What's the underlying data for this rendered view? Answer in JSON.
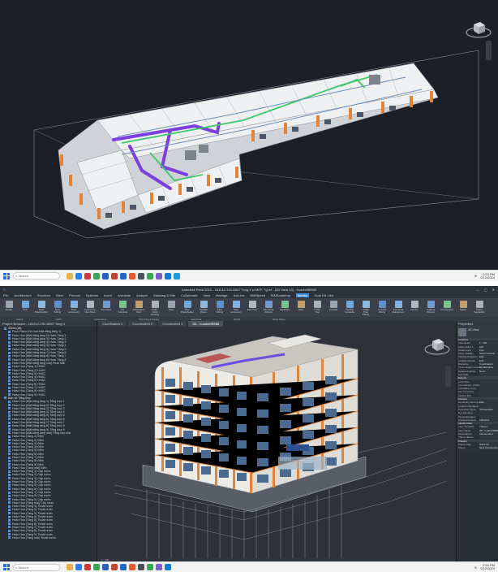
{
  "screen1": {
    "taskbar": {
      "search_placeholder": "Search",
      "time": "2:53 PM",
      "date": "9/12/2024"
    }
  },
  "screen2": {
    "window_title": "Autodesk Revit 2024 - 181012-191-BIM7 Tong 4 (v.MEF, Tg.rvt - {3D View-13} - hoadmi98988",
    "menu_tabs": [
      "File",
      "Architecture",
      "Structure",
      "Steel",
      "Precast",
      "Systems",
      "Insert",
      "Annotate",
      "Analyze",
      "Massing & Site",
      "Collaborate",
      "View",
      "Manage",
      "Add-Ins",
      "BIMSpeed",
      "BIMAcademy",
      "Modify",
      "Xuất Dữ Liệu"
    ],
    "active_tab": "Modify",
    "ribbon_tools": [
      "Modify",
      "Duct",
      "Duct Placeholder",
      "Duct Fitting",
      "Duct Accessory",
      "Convert to Flex Duct",
      "Flex Duct",
      "Air Terminal",
      "Fabrication Part",
      "Multi-Point Routing",
      "Pipe",
      "Pipe Placeholder",
      "Parallel Pipes",
      "Pipe Fitting",
      "Pipe Accessory",
      "Flex Pipe",
      "Plumbing Fixture",
      "Sprinkler",
      "Wire",
      "Cable Tray",
      "Conduit",
      "Parallel Conduits",
      "Cable Tray Fitting",
      "Conduit Fitting",
      "Electrical Equipment",
      "Device",
      "Lighting Fixture",
      "Component",
      "Space",
      "Space Separator"
    ],
    "ribbon_groups": [
      "Select",
      "HVAC",
      "Fabrication",
      "Plumbing & Piping",
      "Electrical",
      "Model",
      "Work Plane"
    ],
    "browser": {
      "title": "Project Browser - 181012-191-BIM7 Tong 4",
      "items": [
        {
          "text": "Views (all)",
          "group": true
        },
        {
          "text": "Floor Plans (Ho ban-Mặt bằng tầng 1)",
          "group": false
        },
        {
          "text": "Hvac Hoa (Mặt bằng tầng 2) Hvac Tầng 1",
          "group": false
        },
        {
          "text": "Hvac Hoa (Mặt bằng tầng 3) Hvac Tầng 2",
          "group": false
        },
        {
          "text": "Hvac Hoa (Mặt bằng tầng 4) Hvac Tầng 3",
          "group": false
        },
        {
          "text": "Hvac Hoa (Mặt bằng tầng 5) Hvac Tầng 4",
          "group": false
        },
        {
          "text": "Hvac Hoa (Mặt bằng tầng 6) Hvac Tầng 5",
          "group": false
        },
        {
          "text": "Hvac Hoa (Mặt bằng tầng 7) Hvac Tầng 6",
          "group": false
        },
        {
          "text": "Hvac Hoa (Mặt bằng tầng 8) Hvac Tầng 7",
          "group": false
        },
        {
          "text": "Hvac Hoa (Mặt bằng tầng 9) Hvac Tầng 8",
          "group": false
        },
        {
          "text": "Hvac Hoa (Mặt bằng tầng mái) Hvac Mái",
          "group": false
        },
        {
          "text": "Hvac Hoa (Tầng 1) HVAC",
          "group": false
        },
        {
          "text": "Hvac Hoa (Tầng 2) HVAC",
          "group": false
        },
        {
          "text": "Hvac Hoa (Tầng 3) HVAC",
          "group": false
        },
        {
          "text": "Hvac Hoa (Tầng 4) HVAC",
          "group": false
        },
        {
          "text": "Hvac Hoa (Tầng 5) HVAC",
          "group": false
        },
        {
          "text": "Hvac Hoa (Tầng 6) HVAC",
          "group": false
        },
        {
          "text": "Hvac Hoa (Tầng 7) HVAC",
          "group": false
        },
        {
          "text": "Hvac Hoa (Tầng 8) HVAC",
          "group": false
        },
        {
          "text": "Hvac Hoa (Tầng 9) HVAC",
          "group": false
        },
        {
          "text": "Bản vẽ Tổng hợp",
          "group": true
        },
        {
          "text": "Hvac Hoa (Mặt bằng tầng 1) Tổng hợp 1",
          "group": false
        },
        {
          "text": "Hvac Hoa (Mặt bằng tầng 2) Tổng hợp 2",
          "group": false
        },
        {
          "text": "Hvac Hoa (Mặt bằng tầng 3) Tổng hợp 3",
          "group": false
        },
        {
          "text": "Hvac Hoa (Mặt bằng tầng 4) Tổng hợp 4",
          "group": false
        },
        {
          "text": "Hvac Hoa (Mặt bằng tầng 5) Tổng hợp 5",
          "group": false
        },
        {
          "text": "Hvac Hoa (Mặt bằng tầng 6) Tổng hợp 6",
          "group": false
        },
        {
          "text": "Hvac Hoa (Mặt bằng tầng 7) Tổng hợp 7",
          "group": false
        },
        {
          "text": "Hvac Hoa (Mặt bằng tầng 8) Tổng hợp 8",
          "group": false
        },
        {
          "text": "Hvac Hoa (Mặt bằng tầng 9) Tổng hợp 9",
          "group": false
        },
        {
          "text": "Hvac Hoa (Mặt bằng tầng mái) Tổng hợp Mái",
          "group": false
        },
        {
          "text": "Hvac Hoa (Tầng 1) Điện",
          "group": false
        },
        {
          "text": "Hvac Hoa (Tầng 2) Điện",
          "group": false
        },
        {
          "text": "Hvac Hoa (Tầng 3) Điện",
          "group": false
        },
        {
          "text": "Hvac Hoa (Tầng 4) Điện",
          "group": false
        },
        {
          "text": "Hvac Hoa (Tầng 5) Điện",
          "group": false
        },
        {
          "text": "Hvac Hoa (Tầng 6) Điện",
          "group": false
        },
        {
          "text": "Hvac Hoa (Tầng 7) Điện",
          "group": false
        },
        {
          "text": "Hvac Hoa (Tầng 8) Điện",
          "group": false
        },
        {
          "text": "Hvac Hoa (Tầng 9) Điện",
          "group": false
        },
        {
          "text": "Hvac Hoa (Tầng mái) Điện",
          "group": false
        },
        {
          "text": "Hvac Hoa (Tầng 1) Cấp nước",
          "group": false
        },
        {
          "text": "Hvac Hoa (Tầng 2) Cấp nước",
          "group": false
        },
        {
          "text": "Hvac Hoa (Tầng 3) Cấp nước",
          "group": false
        },
        {
          "text": "Hvac Hoa (Tầng 4) Cấp nước",
          "group": false
        },
        {
          "text": "Hvac Hoa (Tầng 5) Cấp nước",
          "group": false
        },
        {
          "text": "Hvac Hoa (Tầng 6) Cấp nước",
          "group": false
        },
        {
          "text": "Hvac Hoa (Tầng 7) Cấp nước",
          "group": false
        },
        {
          "text": "Hvac Hoa (Tầng 8) Cấp nước",
          "group": false
        },
        {
          "text": "Hvac Hoa (Tầng 9) Cấp nước",
          "group": false
        },
        {
          "text": "Hvac Hoa (Tầng mái) Cấp nước",
          "group": false
        },
        {
          "text": "Hvac Hoa (Tầng 1) Thoát nước",
          "group": false
        },
        {
          "text": "Hvac Hoa (Tầng 2) Thoát nước",
          "group": false
        },
        {
          "text": "Hvac Hoa (Tầng 3) Thoát nước",
          "group": false
        },
        {
          "text": "Hvac Hoa (Tầng 4) Thoát nước",
          "group": false
        },
        {
          "text": "Hvac Hoa (Tầng 5) Thoát nước",
          "group": false
        },
        {
          "text": "Hvac Hoa (Tầng 6) Thoát nước",
          "group": false
        },
        {
          "text": "Hvac Hoa (Tầng 7) Thoát nước",
          "group": false
        },
        {
          "text": "Hvac Hoa (Tầng 8) Thoát nước",
          "group": false
        },
        {
          "text": "Hvac Hoa (Tầng 9) Thoát nước",
          "group": false
        },
        {
          "text": "Hvac Hoa (Tầng mái) Thoát nước",
          "group": false
        }
      ]
    },
    "view_tabs": [
      "Coordinated 1",
      "Coordinated 2",
      "Coordinated 3",
      "3D - hoadmi98988"
    ],
    "active_view_tab": "3D - hoadmi98988",
    "view_controls": "1 : 100",
    "properties": {
      "title": "Properties",
      "type_name": "3D View",
      "rows": [
        {
          "k": "Graphics",
          "v": "",
          "sec": true
        },
        {
          "k": "View Scale",
          "v": "1 : 100",
          "sec": false
        },
        {
          "k": "Scale Value 1:",
          "v": "100",
          "sec": false
        },
        {
          "k": "Detail Level",
          "v": "Fine",
          "sec": false
        },
        {
          "k": "Parts Visibility",
          "v": "Show Original",
          "sec": false
        },
        {
          "k": "Visibility/Graphics",
          "v": "Edit...",
          "sec": false
        },
        {
          "k": "Graphic Display",
          "v": "Edit...",
          "sec": false
        },
        {
          "k": "Discipline",
          "v": "Coordination",
          "sec": false
        },
        {
          "k": "Show Hidden Lines",
          "v": "By Discipline",
          "sec": false
        },
        {
          "k": "Default Analysis",
          "v": "None",
          "sec": false
        },
        {
          "k": "Sun Path",
          "v": "",
          "sec": false
        },
        {
          "k": "Extents",
          "v": "",
          "sec": true
        },
        {
          "k": "Crop View",
          "v": "",
          "sec": false
        },
        {
          "k": "Crop Region Visible",
          "v": "",
          "sec": false
        },
        {
          "k": "Annotation Crop",
          "v": "",
          "sec": false
        },
        {
          "k": "Far Clip Active",
          "v": "",
          "sec": false
        },
        {
          "k": "Section Box",
          "v": "",
          "sec": false
        },
        {
          "k": "Camera",
          "v": "",
          "sec": true
        },
        {
          "k": "Rendering Settings",
          "v": "Edit...",
          "sec": false
        },
        {
          "k": "Locked Orientation",
          "v": "",
          "sec": false
        },
        {
          "k": "Projection Mode",
          "v": "Orthographic",
          "sec": false
        },
        {
          "k": "Eye Elevation",
          "v": "",
          "sec": false
        },
        {
          "k": "Target Elevation",
          "v": "",
          "sec": false
        },
        {
          "k": "Camera Position",
          "v": "Adjusting",
          "sec": false
        },
        {
          "k": "Identity Data",
          "v": "",
          "sec": true
        },
        {
          "k": "View Template",
          "v": "<None>",
          "sec": false
        },
        {
          "k": "View Name",
          "v": "3D - hoadmi98988",
          "sec": false
        },
        {
          "k": "Dependency",
          "v": "Independent",
          "sec": false
        },
        {
          "k": "Title on Sheet",
          "v": "",
          "sec": false
        },
        {
          "k": "Phasing",
          "v": "",
          "sec": true
        },
        {
          "k": "Phase Filter",
          "v": "Show All",
          "sec": false
        },
        {
          "k": "Phase",
          "v": "New Construction",
          "sec": false
        }
      ]
    },
    "taskbar": {
      "search_placeholder": "Search",
      "time": "2:54 PM",
      "date": "9/12/2024"
    }
  },
  "colors": {
    "accent": "#3d8fd8",
    "duct_purple": "#7b3fe0",
    "pipe_green": "#3fc86b",
    "facade_orange": "#e0843a"
  }
}
